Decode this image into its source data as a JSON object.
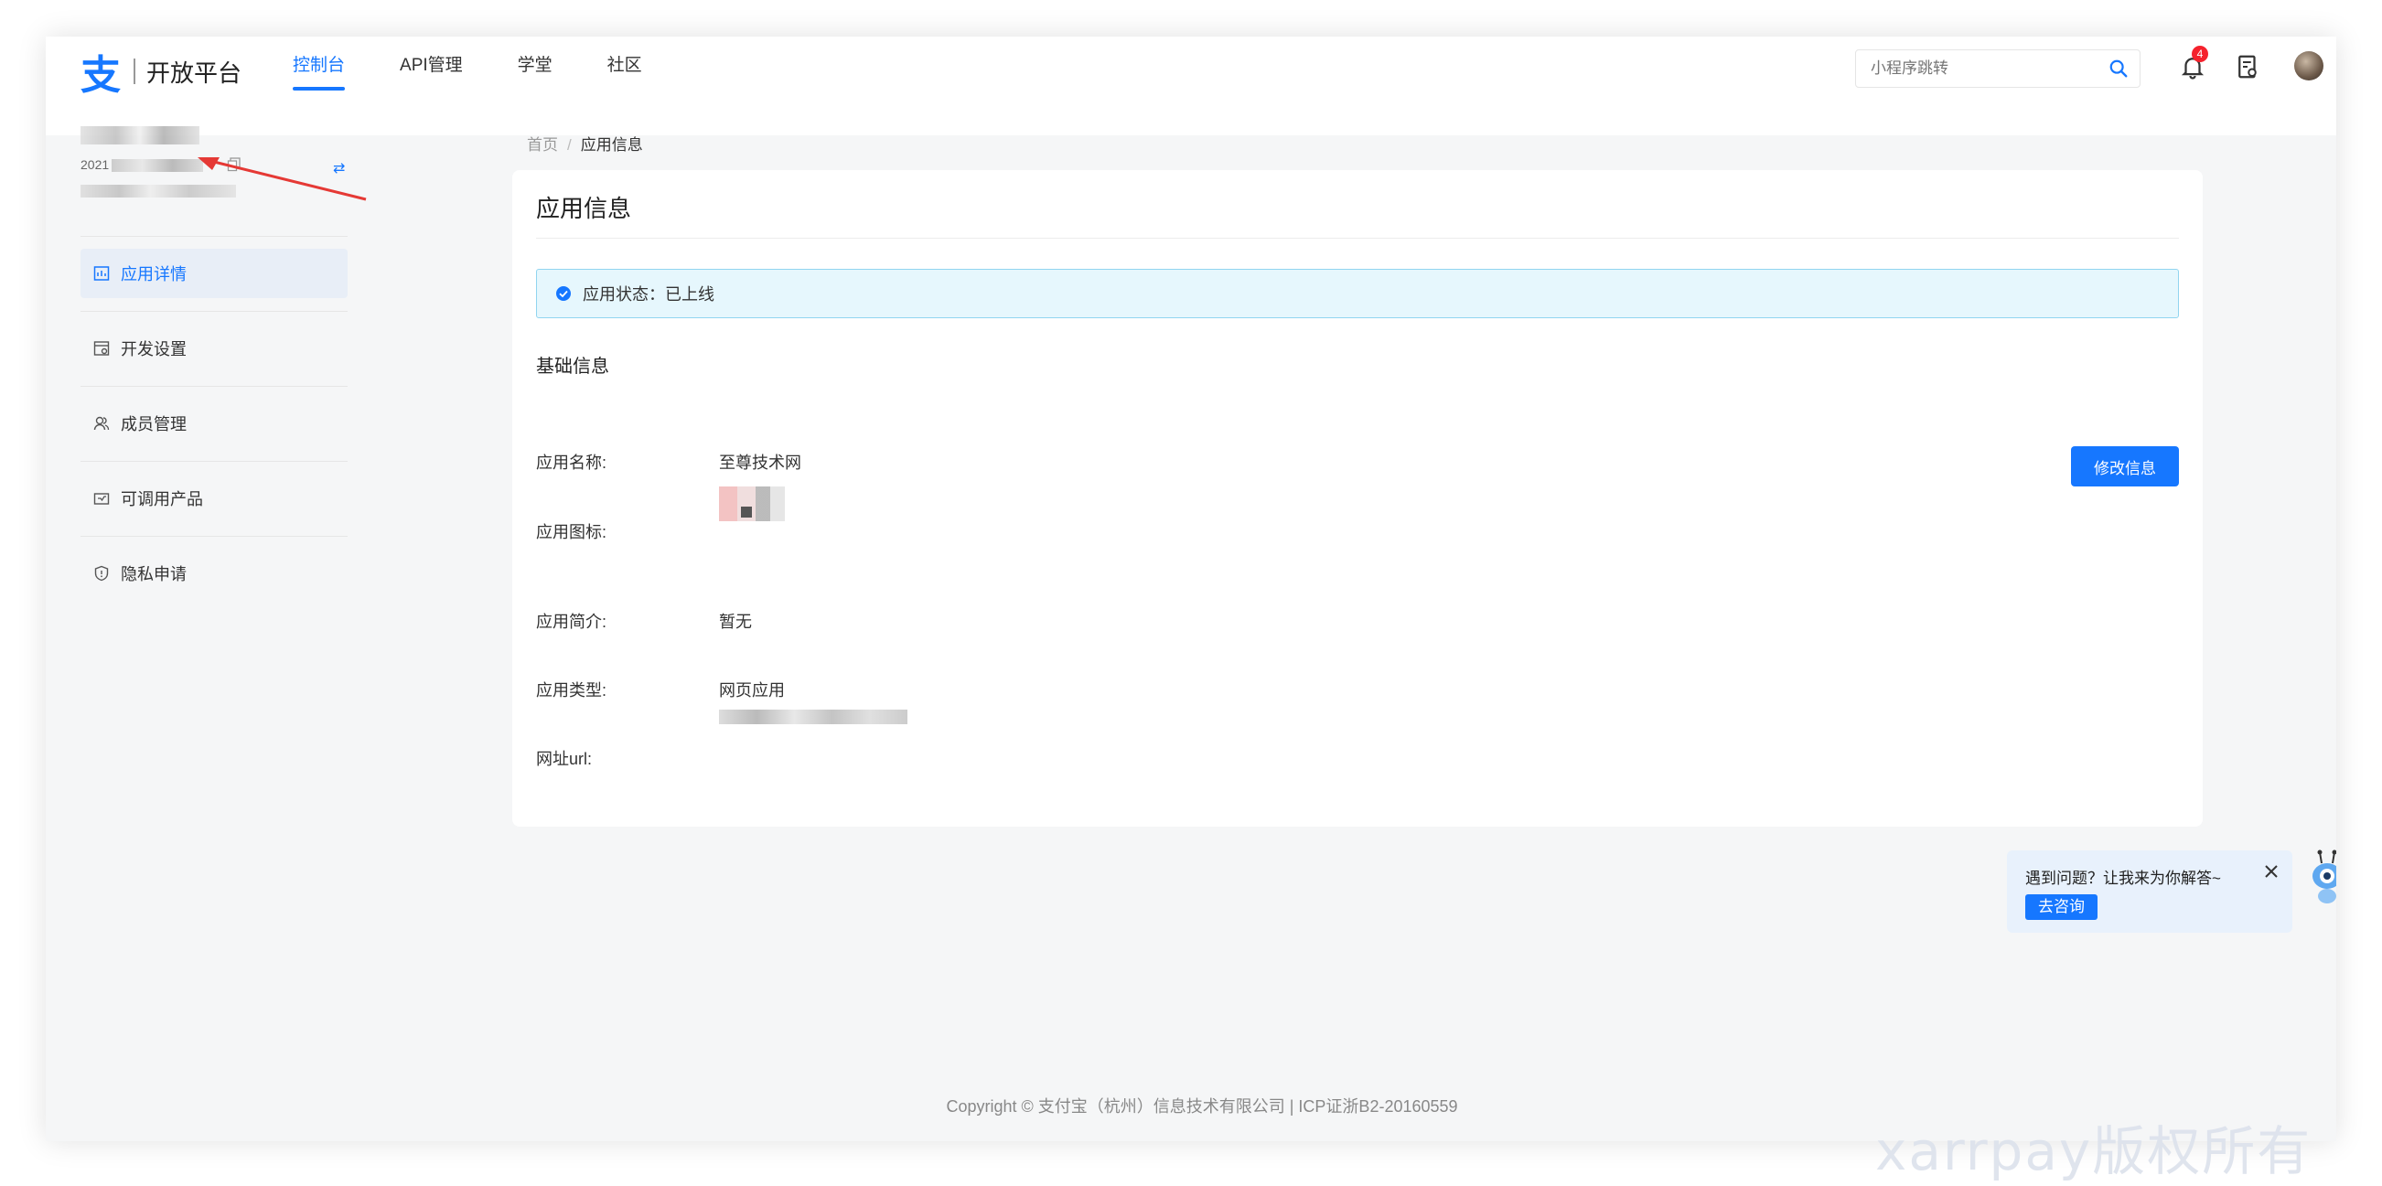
{
  "header": {
    "logo_mark": "支",
    "logo_text": "开放平台",
    "nav": [
      {
        "label": "控制台",
        "active": true
      },
      {
        "label": "API管理",
        "active": false
      },
      {
        "label": "学堂",
        "active": false
      },
      {
        "label": "社区",
        "active": false
      }
    ],
    "search_placeholder": "小程序跳转",
    "notification_count": "4"
  },
  "account": {
    "id_prefix": "2021"
  },
  "sidebar": {
    "items": [
      {
        "label": "应用详情",
        "icon": "app-detail-icon",
        "active": true
      },
      {
        "label": "开发设置",
        "icon": "dev-settings-icon",
        "active": false
      },
      {
        "label": "成员管理",
        "icon": "members-icon",
        "active": false
      },
      {
        "label": "可调用产品",
        "icon": "products-icon",
        "active": false
      },
      {
        "label": "隐私申请",
        "icon": "privacy-shield-icon",
        "active": false
      }
    ]
  },
  "breadcrumb": {
    "home": "首页",
    "separator": "/",
    "current": "应用信息"
  },
  "card": {
    "title": "应用信息",
    "status_text": "应用状态：已上线",
    "section_title": "基础信息",
    "edit_button": "修改信息",
    "fields": [
      {
        "label": "应用名称:",
        "value": "至尊技术网"
      },
      {
        "label": "应用图标:",
        "value": ""
      },
      {
        "label": "应用简介:",
        "value": "暂无"
      },
      {
        "label": "应用类型:",
        "value": "网页应用"
      },
      {
        "label": "网址url:",
        "value": ""
      }
    ]
  },
  "chat": {
    "text": "遇到问题？让我来为你解答~",
    "button": "去咨询"
  },
  "footer": {
    "text": "Copyright © 支付宝（杭州）信息技术有限公司 | ICP证浙B2-20160559"
  },
  "watermark": "xarrpay版权所有",
  "colors": {
    "primary": "#1677ff",
    "badge": "#f5222d",
    "status_bg": "#e6f7fd"
  }
}
